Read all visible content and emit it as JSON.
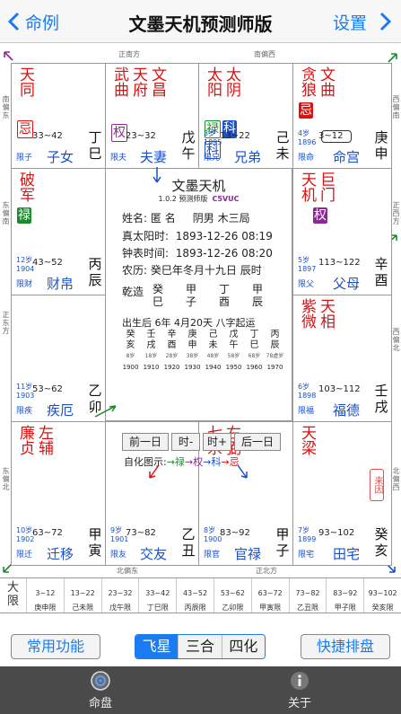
{
  "nav": {
    "back_label": "命例",
    "title": "文墨天机预测师版",
    "right_label": "设置"
  },
  "directions": {
    "top_left": "正南方",
    "top_right": "南偏西",
    "left_top": "南偏东",
    "left_mid_top": "东偏南",
    "left_mid": "正东方",
    "left_bottom": "东偏北",
    "right_top": "西偏南",
    "right_mid_top": "正西方",
    "right_mid": "西偏北",
    "right_bottom": "北偏西",
    "bottom_left": "北偏东",
    "bottom_right": "正北方"
  },
  "palaces": [
    {
      "id": "si",
      "stars": [
        {
          "t": "天同",
          "c": "red"
        }
      ],
      "hua": [
        {
          "t": "忌",
          "c": "red",
          "style": "box"
        }
      ],
      "age": "",
      "year": "",
      "range": "33~42",
      "limit": "限子",
      "palace": "子女",
      "gz": [
        "丁",
        "巳"
      ]
    },
    {
      "id": "wu",
      "stars": [
        {
          "t": "武曲",
          "c": "red"
        },
        {
          "t": "天府",
          "c": "red"
        },
        {
          "t": "文昌",
          "c": "red"
        }
      ],
      "hua": [
        {
          "t": "权",
          "c": "purple",
          "style": "box"
        }
      ],
      "age": "",
      "year": "",
      "range": "23~32",
      "limit": "限夫",
      "palace": "夫妻",
      "gz": [
        "戊",
        "午"
      ]
    },
    {
      "id": "wei",
      "stars": [
        {
          "t": "太阳",
          "c": "red"
        },
        {
          "t": "太阴",
          "c": "red"
        }
      ],
      "hua": [
        {
          "t": "禄",
          "c": "green",
          "style": "box"
        },
        {
          "t": "科",
          "c": "blue",
          "style": "solid"
        },
        {
          "t": "科",
          "c": "blue",
          "style": "box"
        }
      ],
      "age": "3岁",
      "year": "1895",
      "range": "13~22",
      "limit": "限兄",
      "palace": "兄弟",
      "gz": [
        "己",
        "未"
      ]
    },
    {
      "id": "shen",
      "stars": [
        {
          "t": "贪狼",
          "c": "red"
        },
        {
          "t": "文曲",
          "c": "red"
        }
      ],
      "hua": [
        {
          "t": "忌",
          "c": "red",
          "style": "solid"
        }
      ],
      "age": "4岁",
      "year": "1896",
      "range": "3~12",
      "limit": "限命",
      "palace": "命宫",
      "gz": [
        "庚",
        "申"
      ]
    },
    {
      "id": "chen",
      "stars": [
        {
          "t": "破军",
          "c": "red"
        }
      ],
      "hua": [
        {
          "t": "禄",
          "c": "green",
          "style": "solid"
        }
      ],
      "age": "12岁",
      "year": "1904",
      "range": "43~52",
      "limit": "限财",
      "palace": "财帛",
      "gz": [
        "丙",
        "辰"
      ]
    },
    {
      "id": "you",
      "stars": [
        {
          "t": "天机",
          "c": "red"
        },
        {
          "t": "巨门",
          "c": "red"
        }
      ],
      "hua": [
        {
          "t": "权",
          "c": "purple",
          "style": "solid"
        }
      ],
      "age": "5岁",
      "year": "1897",
      "range": "113~122",
      "limit": "限父",
      "palace": "父母",
      "gz": [
        "辛",
        "酉"
      ]
    },
    {
      "id": "mao",
      "stars": [],
      "hua": [],
      "age": "11岁",
      "year": "1903",
      "range": "53~62",
      "limit": "限疾",
      "palace": "疾厄",
      "gz": [
        "乙",
        "卯"
      ]
    },
    {
      "id": "xu",
      "stars": [
        {
          "t": "紫微",
          "c": "red"
        },
        {
          "t": "天相",
          "c": "red"
        }
      ],
      "hua": [],
      "age": "6岁",
      "year": "1898",
      "range": "103~112",
      "limit": "限福",
      "palace": "福德",
      "gz": [
        "壬",
        "戌"
      ]
    },
    {
      "id": "yin",
      "stars": [
        {
          "t": "廉贞",
          "c": "red"
        },
        {
          "t": "左辅",
          "c": "red"
        }
      ],
      "hua": [],
      "age": "10岁",
      "year": "1902",
      "range": "63~72",
      "limit": "限迁",
      "palace": "迁移",
      "gz": [
        "甲",
        "寅"
      ]
    },
    {
      "id": "chou",
      "stars": [],
      "hua": [],
      "age": "9岁",
      "year": "1901",
      "range": "73~82",
      "limit": "限友",
      "palace": "交友",
      "gz": [
        "乙",
        "丑"
      ]
    },
    {
      "id": "zi",
      "stars": [
        {
          "t": "七杀",
          "c": "red"
        },
        {
          "t": "右弼",
          "c": "red"
        }
      ],
      "hua": [],
      "age": "8岁",
      "year": "1900",
      "range": "83~92",
      "limit": "限官",
      "palace": "官禄",
      "gz": [
        "甲",
        "子"
      ]
    },
    {
      "id": "hai",
      "stars": [
        {
          "t": "天梁",
          "c": "red"
        }
      ],
      "hua": [],
      "age": "7岁",
      "year": "1899",
      "range": "93~102",
      "limit": "限宅",
      "palace": "田宅",
      "gz": [
        "癸",
        "亥"
      ]
    }
  ],
  "stamp": "来因",
  "center": {
    "title": "文墨天机",
    "version": "1.0.2 预测师版",
    "code": "C5VUC",
    "name_label": "姓名:",
    "name_value": "匿 名",
    "gender_ju": "阴男 木三局",
    "true_solar_label": "真太阳时:",
    "true_solar_value": "1893-12-26 08:19",
    "clock_label": "钟表时间:",
    "clock_value": "1893-12-26 08:20",
    "lunar_label": "农历:",
    "lunar_value": "癸巳年冬月十九日 辰时",
    "qianzao_label": "乾造",
    "bazi_top": [
      "癸",
      "甲",
      "丁",
      "甲"
    ],
    "bazi_bottom": [
      "巳",
      "子",
      "酉",
      "辰"
    ],
    "dayun_title": "出生后 6年 4月20天 八字起运",
    "dayun_top": [
      "癸",
      "壬",
      "辛",
      "庚",
      "己",
      "戊",
      "丁",
      "丙"
    ],
    "dayun_bottom": [
      "亥",
      "戌",
      "酉",
      "申",
      "未",
      "午",
      "巳",
      "辰"
    ],
    "dayun_ages": [
      "8岁",
      "18岁",
      "28岁",
      "38岁",
      "48岁",
      "58岁",
      "68岁",
      "78虚岁"
    ],
    "dayun_years": [
      "1900",
      "1910",
      "1920",
      "1930",
      "1940",
      "1950",
      "1960",
      "1970"
    ],
    "buttons": [
      "前一日",
      "时-",
      "时+",
      "后一日"
    ],
    "selfhua_label": "自化图示:",
    "selfhua_items": [
      {
        "t": "→禄",
        "c": "green"
      },
      {
        "t": "→权",
        "c": "purple"
      },
      {
        "t": "→科",
        "c": "blue"
      },
      {
        "t": "→忌",
        "c": "red"
      }
    ]
  },
  "daxian_tabs": {
    "first": [
      "大",
      "限"
    ],
    "items": [
      "3~12 庚申限",
      "13~22 己未限",
      "23~32 戊午限",
      "33~42 丁巳限",
      "43~52 丙辰限",
      "53~62 乙卯限",
      "63~72 甲寅限",
      "73~82 乙丑限",
      "83~92 甲子限",
      "93~102 癸亥限"
    ]
  },
  "bottom": {
    "common": "常用功能",
    "seg": [
      "飞星",
      "三合",
      "四化"
    ],
    "quick": "快捷排盘"
  },
  "tabbar": {
    "left": "命盘",
    "right": "关于"
  },
  "colors": {
    "accent": "#1a7cf0",
    "red": "#dd1111",
    "blue": "#1a50c8",
    "green": "#1a8a2c",
    "purple": "#8c2896"
  }
}
